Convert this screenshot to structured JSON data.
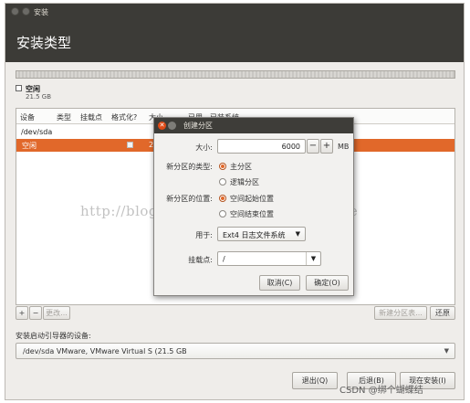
{
  "window": {
    "title": "安装",
    "page_title": "安装类型"
  },
  "free_space": {
    "label": "空闲",
    "size": "21.5 GB"
  },
  "table": {
    "columns": [
      "设备",
      "类型",
      "挂载点",
      "格式化?",
      "大小",
      "已用",
      "已装系统"
    ],
    "device_row": "/dev/sda",
    "selected_row": {
      "device": "空闲",
      "size": "21"
    }
  },
  "toolbar": {
    "add": "+",
    "remove": "−",
    "change": "更改...",
    "new_table": "新建分区表...",
    "revert": "还原"
  },
  "boot_loader": {
    "label": "安装启动引导器的设备:",
    "device": "/dev/sda   VMware, VMware Virtual S (21.5 GB"
  },
  "actions": {
    "quit": "退出(Q)",
    "back": "后退(B)",
    "install": "现在安装(I)"
  },
  "dialog": {
    "title": "创建分区",
    "size_label": "大小:",
    "size_value": "6000",
    "size_minus": "−",
    "size_plus": "+",
    "size_unit": "MB",
    "type_label": "新分区的类型:",
    "type_options": [
      "主分区",
      "逻辑分区"
    ],
    "location_label": "新分区的位置:",
    "location_options": [
      "空间起始位置",
      "空间结束位置"
    ],
    "use_label": "用于:",
    "use_value": "Ext4 日志文件系统",
    "mount_label": "挂载点:",
    "mount_value": "/",
    "cancel": "取消(C)",
    "ok": "确定(O)"
  },
  "watermark": "http://blog.csdn.net/zhangxiangweide",
  "footer_watermark": "CSDN @绑个蝴蝶结",
  "colors": {
    "accent": "#e1682a",
    "titlebar": "#3c3b37",
    "dialog_title": "#3e3d39"
  }
}
